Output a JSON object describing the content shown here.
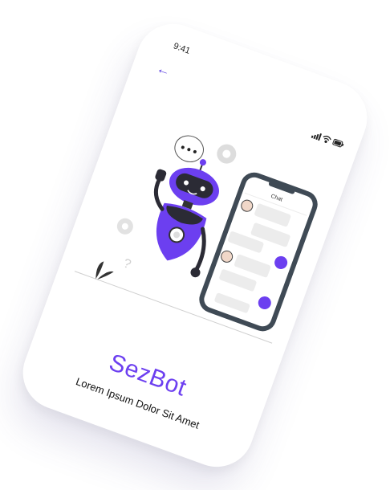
{
  "status_bar": {
    "time": "9:41"
  },
  "nav": {
    "back_icon": "arrow-left-icon"
  },
  "illustration": {
    "chat_header": "Chat",
    "accent_color": "#6c3ff0"
  },
  "hero": {
    "app_name": "SezBot",
    "tagline": "Lorem Ipsum Dolor Sit Amet"
  }
}
